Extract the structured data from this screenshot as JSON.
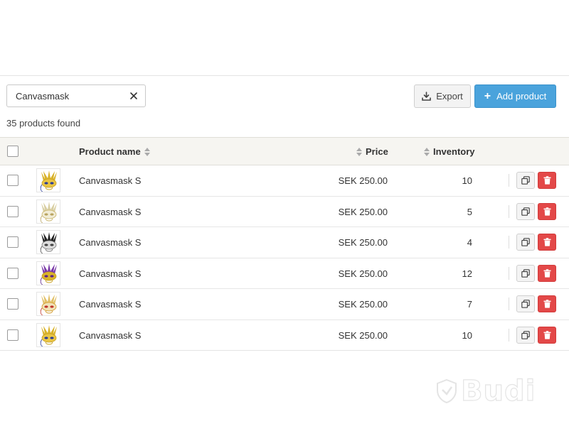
{
  "search": {
    "value": "Canvasmask",
    "placeholder": ""
  },
  "toolbar": {
    "export_label": "Export",
    "add_label": "Add product"
  },
  "results": {
    "count_text": "35 products found"
  },
  "table": {
    "headers": {
      "name": "Product name",
      "price": "Price",
      "inventory": "Inventory"
    },
    "rows": [
      {
        "name": "Canvasmask S",
        "price": "SEK 250.00",
        "inventory": "10",
        "thumb": "gold-blue-mask"
      },
      {
        "name": "Canvasmask S",
        "price": "SEK 250.00",
        "inventory": "5",
        "thumb": "white-gold-mask"
      },
      {
        "name": "Canvasmask S",
        "price": "SEK 250.00",
        "inventory": "4",
        "thumb": "black-white-feather-mask"
      },
      {
        "name": "Canvasmask S",
        "price": "SEK 250.00",
        "inventory": "12",
        "thumb": "purple-gold-mask"
      },
      {
        "name": "Canvasmask S",
        "price": "SEK 250.00",
        "inventory": "7",
        "thumb": "red-gold-star-mask"
      },
      {
        "name": "Canvasmask S",
        "price": "SEK 250.00",
        "inventory": "10",
        "thumb": "gold-blue-mask"
      }
    ]
  },
  "icons": {
    "clear": "close-icon",
    "export": "download-icon",
    "add": "plus-icon",
    "sort": "sort-icon",
    "copy": "copy-icon",
    "delete": "trash-icon"
  },
  "colors": {
    "primary": "#4aa3dc",
    "danger": "#e34848",
    "header_bg": "#f6f5f1"
  },
  "watermark": {
    "text": "Budi"
  }
}
